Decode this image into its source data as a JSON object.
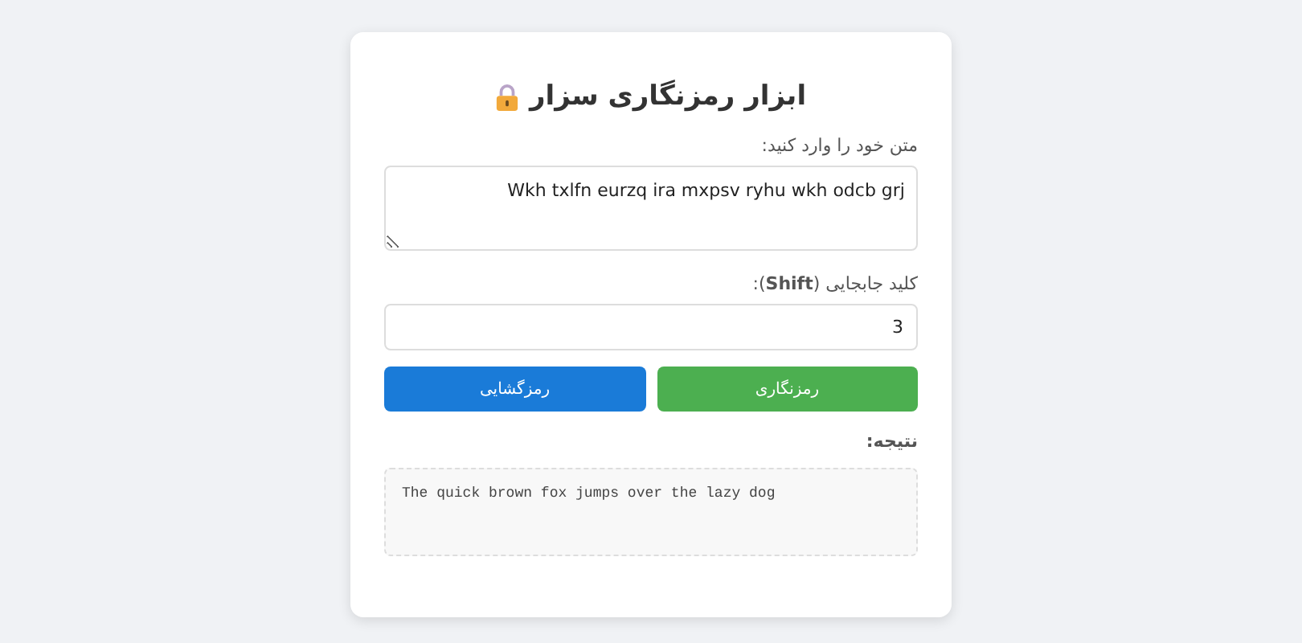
{
  "card": {
    "title": "ابزار رمزنگاری سزار",
    "text_field": {
      "label": "متن خود را وارد کنید:",
      "value": "Wkh txlfn eurzq ira mxpsv ryhu wkh odcb grj"
    },
    "shift_field": {
      "label": "کلید جابجایی (**Shift**):",
      "value": "3"
    },
    "buttons": [
      {
        "label": "رمزنگاری",
        "kind": "encrypt"
      },
      {
        "label": "رمزگشایی",
        "kind": "decrypt"
      }
    ],
    "result": {
      "label": "نتیجه:",
      "text": "The quick brown fox jumps over the lazy dog"
    }
  }
}
